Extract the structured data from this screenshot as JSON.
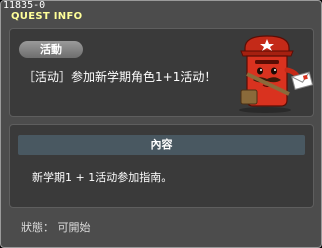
{
  "quest_id": "11835-0",
  "window_title": "QUEST INFO",
  "category_badge": "活動",
  "quest_name": "［活动］参加新学期角色1+1活动！",
  "content_header": "內容",
  "content_text": "新学期1 + 1活动参加指南。",
  "status": {
    "text": "狀態： 可開始"
  },
  "icons": {
    "mascot": "red-mailbox-mascot-icon"
  },
  "colors": {
    "title": "#ffff99",
    "window_bg": "#4c4c4c",
    "panel_bg": "#3a3a3a",
    "header_bar": "#495861",
    "mascot_red": "#d9321f"
  }
}
